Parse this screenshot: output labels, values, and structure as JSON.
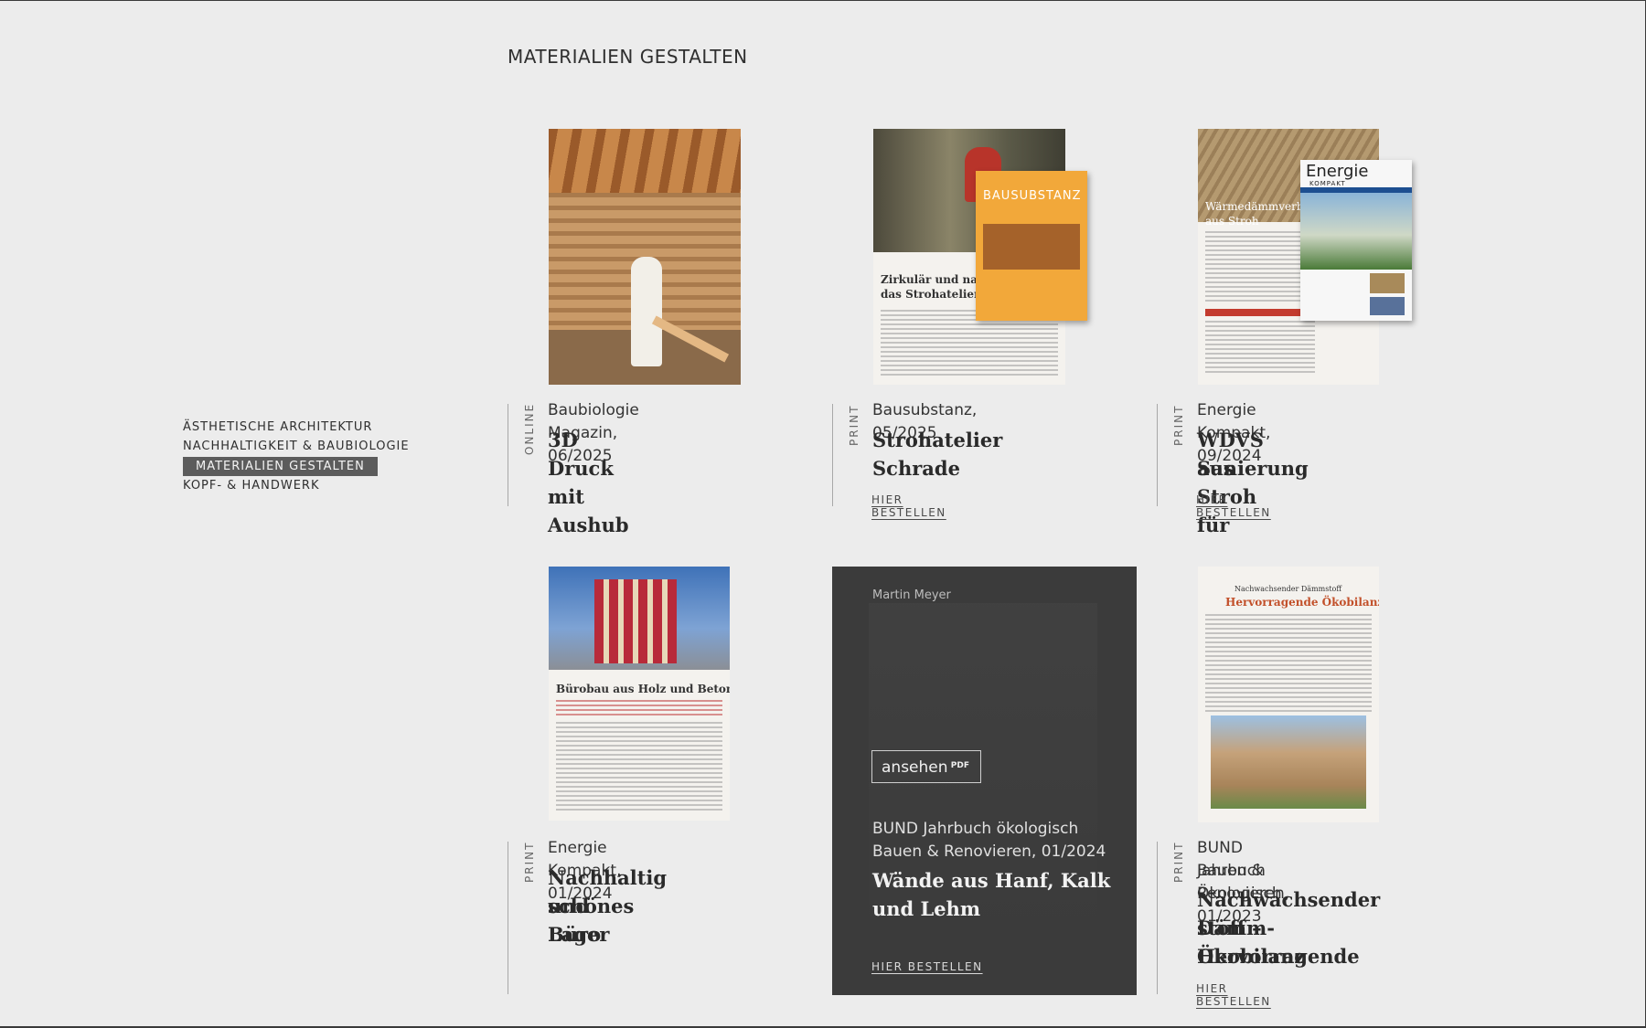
{
  "page": {
    "title": "MATERIALIEN GESTALTEN"
  },
  "nav": {
    "items": [
      {
        "label": "ÄSTHETISCHE ARCHITEKTUR",
        "active": false
      },
      {
        "label": "NACHHALTIGKEIT & BAUBIOLOGIE",
        "active": false
      },
      {
        "label": "MATERIALIEN GESTALTEN",
        "active": true
      },
      {
        "label": "KOPF- & HANDWERK",
        "active": false
      }
    ]
  },
  "colors": {
    "background": "#ececec",
    "nav_active_bg": "#5c5c5c",
    "dark_card_bg": "#3b3b3b",
    "cover_orange": "#f2a83a"
  },
  "articles": [
    {
      "type": "ONLINE",
      "source": "Baubiologie Magazin, 06/2025",
      "title": "3D Druck mit Aushub"
    },
    {
      "type": "PRINT",
      "source": "Bausubstanz, 05/2025",
      "title": "Strohatelier Schrade",
      "order": "HIER BESTELLEN",
      "cover_label": "BAUSUBSTANZ",
      "page_head_1": "Zirkulär und nach",
      "page_head_2": "das Strohatelier S"
    },
    {
      "type": "PRINT",
      "source": "Energie Kompakt, 09/2024",
      "title_1": "WDVS aus Stroh für",
      "title_2": "Sanierung",
      "order": "HIER BESTELLEN",
      "cover_label_1": "Energie",
      "cover_label_2": "KOMPAKT",
      "page_head_1": "Wärmedämmverbund",
      "page_head_2": "aus Stroh"
    },
    {
      "type": "PRINT",
      "source": "Energie Kompakt, 01/2024",
      "title_1": "Nachhaltig schönes Büro",
      "title_2": "und Lager",
      "page_head": "Bürobau aus Holz und Beton"
    },
    {
      "author": "Martin Meyer",
      "view_label": "ansehen",
      "view_badge": "PDF",
      "source_1": "BUND Jahrbuch ökologisch",
      "source_2": "Bauen & Renovieren, 01/2024",
      "title_1": "Wände aus Hanf, Kalk",
      "title_2": "und Lehm",
      "order": "HIER BESTELLEN"
    },
    {
      "type": "PRINT",
      "source_1": "BUND Jahrbuch Ökologisch",
      "source_2": "Bauen & Renovieren, 01/2023",
      "title_1": "Nachwachsender Dämm-",
      "title_2": "stoff – Hervorragende",
      "title_3": "Ökobilanz",
      "order": "HIER BESTELLEN",
      "page_head_1": "Nachwachsender Dämmstoff",
      "page_head_2": "Hervorragende Ökobilanz"
    }
  ]
}
